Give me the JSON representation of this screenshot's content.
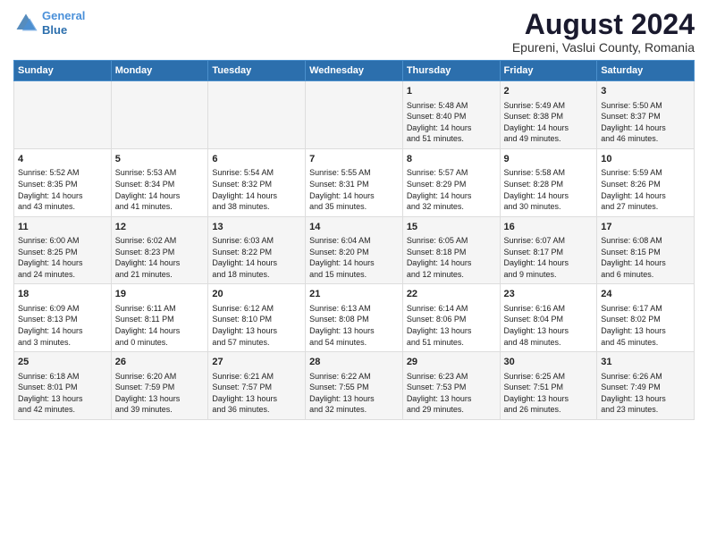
{
  "logo": {
    "line1": "General",
    "line2": "Blue"
  },
  "title": "August 2024",
  "subtitle": "Epureni, Vaslui County, Romania",
  "days_of_week": [
    "Sunday",
    "Monday",
    "Tuesday",
    "Wednesday",
    "Thursday",
    "Friday",
    "Saturday"
  ],
  "weeks": [
    {
      "cells": [
        {
          "day": "",
          "content": ""
        },
        {
          "day": "",
          "content": ""
        },
        {
          "day": "",
          "content": ""
        },
        {
          "day": "",
          "content": ""
        },
        {
          "day": "1",
          "content": "Sunrise: 5:48 AM\nSunset: 8:40 PM\nDaylight: 14 hours\nand 51 minutes."
        },
        {
          "day": "2",
          "content": "Sunrise: 5:49 AM\nSunset: 8:38 PM\nDaylight: 14 hours\nand 49 minutes."
        },
        {
          "day": "3",
          "content": "Sunrise: 5:50 AM\nSunset: 8:37 PM\nDaylight: 14 hours\nand 46 minutes."
        }
      ]
    },
    {
      "cells": [
        {
          "day": "4",
          "content": "Sunrise: 5:52 AM\nSunset: 8:35 PM\nDaylight: 14 hours\nand 43 minutes."
        },
        {
          "day": "5",
          "content": "Sunrise: 5:53 AM\nSunset: 8:34 PM\nDaylight: 14 hours\nand 41 minutes."
        },
        {
          "day": "6",
          "content": "Sunrise: 5:54 AM\nSunset: 8:32 PM\nDaylight: 14 hours\nand 38 minutes."
        },
        {
          "day": "7",
          "content": "Sunrise: 5:55 AM\nSunset: 8:31 PM\nDaylight: 14 hours\nand 35 minutes."
        },
        {
          "day": "8",
          "content": "Sunrise: 5:57 AM\nSunset: 8:29 PM\nDaylight: 14 hours\nand 32 minutes."
        },
        {
          "day": "9",
          "content": "Sunrise: 5:58 AM\nSunset: 8:28 PM\nDaylight: 14 hours\nand 30 minutes."
        },
        {
          "day": "10",
          "content": "Sunrise: 5:59 AM\nSunset: 8:26 PM\nDaylight: 14 hours\nand 27 minutes."
        }
      ]
    },
    {
      "cells": [
        {
          "day": "11",
          "content": "Sunrise: 6:00 AM\nSunset: 8:25 PM\nDaylight: 14 hours\nand 24 minutes."
        },
        {
          "day": "12",
          "content": "Sunrise: 6:02 AM\nSunset: 8:23 PM\nDaylight: 14 hours\nand 21 minutes."
        },
        {
          "day": "13",
          "content": "Sunrise: 6:03 AM\nSunset: 8:22 PM\nDaylight: 14 hours\nand 18 minutes."
        },
        {
          "day": "14",
          "content": "Sunrise: 6:04 AM\nSunset: 8:20 PM\nDaylight: 14 hours\nand 15 minutes."
        },
        {
          "day": "15",
          "content": "Sunrise: 6:05 AM\nSunset: 8:18 PM\nDaylight: 14 hours\nand 12 minutes."
        },
        {
          "day": "16",
          "content": "Sunrise: 6:07 AM\nSunset: 8:17 PM\nDaylight: 14 hours\nand 9 minutes."
        },
        {
          "day": "17",
          "content": "Sunrise: 6:08 AM\nSunset: 8:15 PM\nDaylight: 14 hours\nand 6 minutes."
        }
      ]
    },
    {
      "cells": [
        {
          "day": "18",
          "content": "Sunrise: 6:09 AM\nSunset: 8:13 PM\nDaylight: 14 hours\nand 3 minutes."
        },
        {
          "day": "19",
          "content": "Sunrise: 6:11 AM\nSunset: 8:11 PM\nDaylight: 14 hours\nand 0 minutes."
        },
        {
          "day": "20",
          "content": "Sunrise: 6:12 AM\nSunset: 8:10 PM\nDaylight: 13 hours\nand 57 minutes."
        },
        {
          "day": "21",
          "content": "Sunrise: 6:13 AM\nSunset: 8:08 PM\nDaylight: 13 hours\nand 54 minutes."
        },
        {
          "day": "22",
          "content": "Sunrise: 6:14 AM\nSunset: 8:06 PM\nDaylight: 13 hours\nand 51 minutes."
        },
        {
          "day": "23",
          "content": "Sunrise: 6:16 AM\nSunset: 8:04 PM\nDaylight: 13 hours\nand 48 minutes."
        },
        {
          "day": "24",
          "content": "Sunrise: 6:17 AM\nSunset: 8:02 PM\nDaylight: 13 hours\nand 45 minutes."
        }
      ]
    },
    {
      "cells": [
        {
          "day": "25",
          "content": "Sunrise: 6:18 AM\nSunset: 8:01 PM\nDaylight: 13 hours\nand 42 minutes."
        },
        {
          "day": "26",
          "content": "Sunrise: 6:20 AM\nSunset: 7:59 PM\nDaylight: 13 hours\nand 39 minutes."
        },
        {
          "day": "27",
          "content": "Sunrise: 6:21 AM\nSunset: 7:57 PM\nDaylight: 13 hours\nand 36 minutes."
        },
        {
          "day": "28",
          "content": "Sunrise: 6:22 AM\nSunset: 7:55 PM\nDaylight: 13 hours\nand 32 minutes."
        },
        {
          "day": "29",
          "content": "Sunrise: 6:23 AM\nSunset: 7:53 PM\nDaylight: 13 hours\nand 29 minutes."
        },
        {
          "day": "30",
          "content": "Sunrise: 6:25 AM\nSunset: 7:51 PM\nDaylight: 13 hours\nand 26 minutes."
        },
        {
          "day": "31",
          "content": "Sunrise: 6:26 AM\nSunset: 7:49 PM\nDaylight: 13 hours\nand 23 minutes."
        }
      ]
    }
  ]
}
